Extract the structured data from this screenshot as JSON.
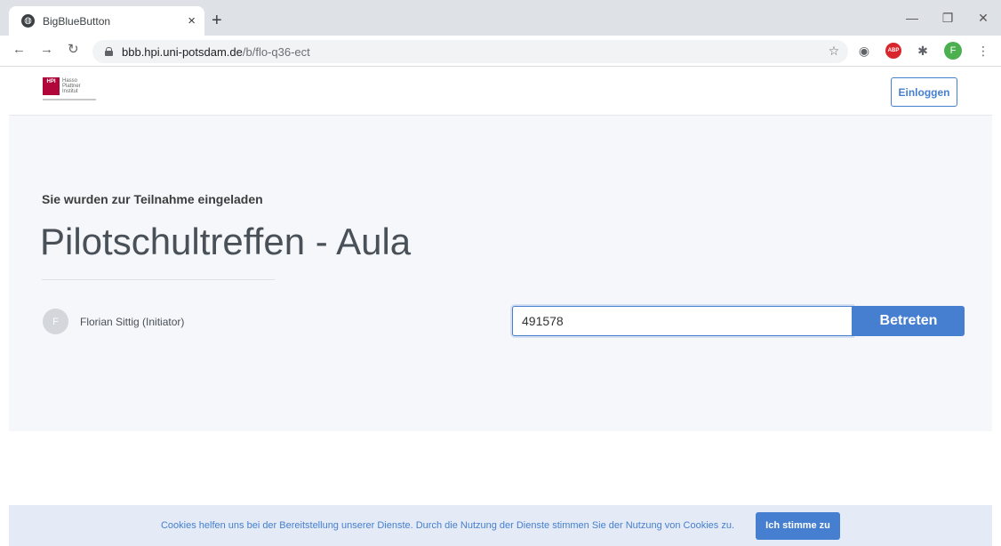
{
  "browser": {
    "tab_title": "BigBlueButton",
    "tab_close": "×",
    "new_tab": "+",
    "url_host": "bbb.hpi.uni-potsdam.de",
    "url_path": "/b/flo-q36-ect",
    "profile_initial": "F",
    "abp_label": "ABP"
  },
  "header": {
    "logo_mark": "HPI",
    "logo_name": "Hasso Plattner Institut",
    "login_label": "Einloggen"
  },
  "room": {
    "invite_text": "Sie wurden zur Teilnahme eingeladen",
    "title": "Pilotschultreffen - Aula",
    "owner_initial": "F",
    "owner_name": "Florian Sittig (Initiator)",
    "name_input_value": "491578",
    "join_label": "Betreten"
  },
  "cookie": {
    "text": "Cookies helfen uns bei der Bereitstellung unserer Dienste. Durch die Nutzung der Dienste stimmen Sie der Nutzung von Cookies zu.",
    "accept_label": "Ich stimme zu"
  },
  "colors": {
    "accent": "#467fcf",
    "hero_bg": "#f5f7fb",
    "logo_red": "#b1063a"
  }
}
